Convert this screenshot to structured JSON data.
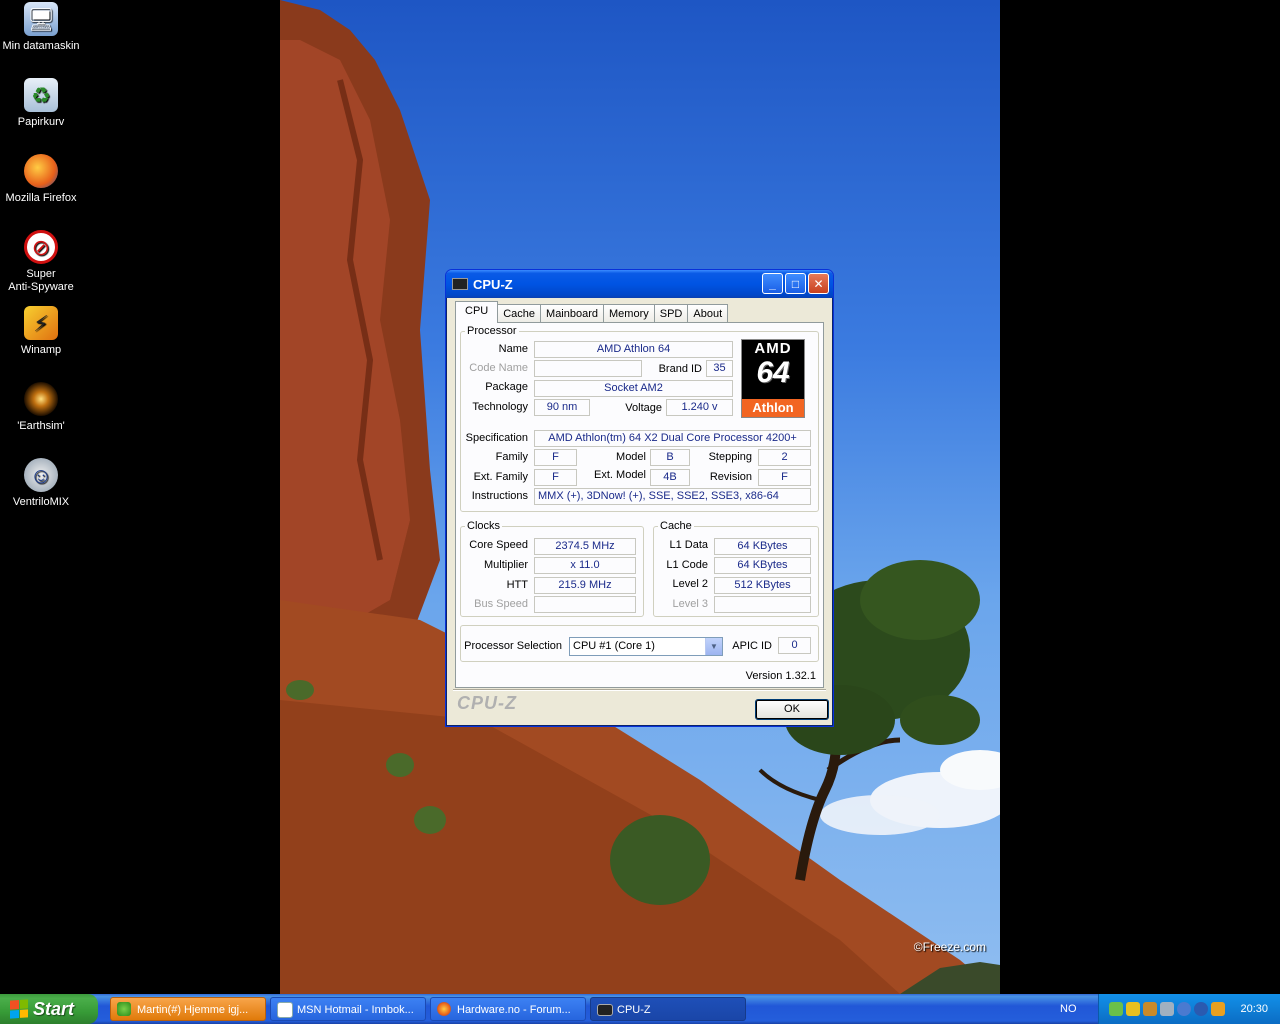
{
  "desktop": {
    "icons": [
      {
        "label": "Min datamaskin",
        "icon": "computer-icon"
      },
      {
        "label": "Papirkurv",
        "icon": "recycle-bin-icon"
      },
      {
        "label": "Mozilla Firefox",
        "icon": "firefox-icon"
      },
      {
        "label": "Super\nAnti-Spyware",
        "icon": "antispyware-icon"
      },
      {
        "label": "Winamp",
        "icon": "winamp-icon"
      },
      {
        "label": "'Earthsim'",
        "icon": "earthsim-icon"
      },
      {
        "label": "VentriloMIX",
        "icon": "ventrilo-icon"
      }
    ],
    "wallpaper_credit": "©Freeze.com"
  },
  "window": {
    "title": "CPU-Z",
    "tabs": [
      "CPU",
      "Cache",
      "Mainboard",
      "Memory",
      "SPD",
      "About"
    ],
    "active_tab": "CPU",
    "processor": {
      "legend": "Processor",
      "name_label": "Name",
      "name": "AMD Athlon 64",
      "codename_label": "Code Name",
      "codename": "",
      "brandid_label": "Brand ID",
      "brandid": "35",
      "package_label": "Package",
      "package": "Socket AM2",
      "technology_label": "Technology",
      "technology": "90 nm",
      "voltage_label": "Voltage",
      "voltage": "1.240 v",
      "spec_label": "Specification",
      "spec": "AMD Athlon(tm) 64 X2 Dual Core Processor 4200+",
      "family_label": "Family",
      "family": "F",
      "model_label": "Model",
      "model": "B",
      "stepping_label": "Stepping",
      "stepping": "2",
      "extfamily_label": "Ext. Family",
      "extfamily": "F",
      "extmodel_label": "Ext. Model",
      "extmodel": "4B",
      "revision_label": "Revision",
      "revision": "F",
      "instructions_label": "Instructions",
      "instructions": "MMX (+), 3DNow! (+), SSE, SSE2, SSE3, x86-64",
      "logo": {
        "top": "AMD",
        "middle": "64",
        "bottom": "Athlon"
      }
    },
    "clocks": {
      "legend": "Clocks",
      "core_label": "Core Speed",
      "core": "2374.5 MHz",
      "mult_label": "Multiplier",
      "mult": "x 11.0",
      "htt_label": "HTT",
      "htt": "215.9 MHz",
      "bus_label": "Bus Speed",
      "bus": ""
    },
    "cache": {
      "legend": "Cache",
      "l1d_label": "L1 Data",
      "l1d": "64 KBytes",
      "l1c_label": "L1 Code",
      "l1c": "64 KBytes",
      "l2_label": "Level 2",
      "l2": "512 KBytes",
      "l3_label": "Level 3",
      "l3": ""
    },
    "selection": {
      "label": "Processor Selection",
      "value": "CPU #1 (Core 1)",
      "apic_label": "APIC ID",
      "apic": "0"
    },
    "version": "Version 1.32.1",
    "brand": "CPU-Z",
    "ok": "OK"
  },
  "taskbar": {
    "start": "Start",
    "tasks": [
      {
        "label": "Martin(#) Hjemme igj...",
        "state": "flash"
      },
      {
        "label": "MSN Hotmail - Innbok...",
        "state": "normal"
      },
      {
        "label": "Hardware.no - Forum...",
        "state": "normal"
      },
      {
        "label": "CPU-Z",
        "state": "active"
      }
    ],
    "language": "NO",
    "clock": "20:30"
  },
  "colors": {
    "value_text": "#1a2a8a",
    "xp_blue": "#0054e3",
    "start_green": "#379b37",
    "amd_orange": "#f26522"
  }
}
